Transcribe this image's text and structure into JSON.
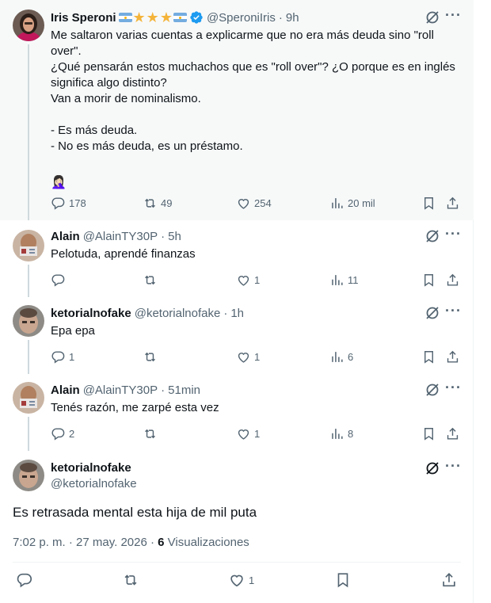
{
  "tweets": [
    {
      "name": "Iris Speroni",
      "handle": "@SperoniIris",
      "time": "9h",
      "lines": [
        "Me saltaron varias cuentas a explicarme que no era más deuda sino \"roll",
        "over\".",
        "¿Qué pensarán estos muchachos que es \"roll over\"? ¿O porque es en inglés",
        "significa algo distinto?",
        "Van a morir de nominalismo.",
        "",
        "- Es más deuda.",
        "- No es más deuda, es un préstamo.",
        "",
        "🤦🏻‍♀️"
      ],
      "replies": "178",
      "retweets": "49",
      "likes": "254",
      "views": "20 mil"
    },
    {
      "name": "Alain",
      "handle": "@AlainTY30P",
      "time": "5h",
      "text": "Pelotuda, aprendé finanzas",
      "replies": "",
      "retweets": "",
      "likes": "1",
      "views": "11"
    },
    {
      "name": "ketorialnofake",
      "handle": "@ketorialnofake",
      "time": "1h",
      "text": "Epa epa",
      "replies": "1",
      "retweets": "",
      "likes": "1",
      "views": "6"
    },
    {
      "name": "Alain",
      "handle": "@AlainTY30P",
      "time": "51min",
      "text": "Tenés razón, me zarpé esta vez",
      "replies": "2",
      "retweets": "",
      "likes": "1",
      "views": "8"
    }
  ],
  "main": {
    "name": "ketorialnofake",
    "handle": "@ketorialnofake",
    "text": "Es retrasada mental esta hija de mil puta",
    "timestamp": "7:02 p. m. · 27 may. 2026",
    "separator": "·",
    "views_count": "6",
    "views_label": "Visualizaciones",
    "likes": "1"
  },
  "sep": "·",
  "icons": [
    "reply-icon",
    "retweet-icon",
    "like-icon",
    "views-icon",
    "bookmark-icon",
    "share-icon",
    "grok-icon",
    "more-icon",
    "verified-icon"
  ],
  "colors": {
    "text": "#0f1419",
    "secondary": "#536471",
    "verified": "#1d9bf0",
    "highlight_bg": "#f7f9f9"
  }
}
